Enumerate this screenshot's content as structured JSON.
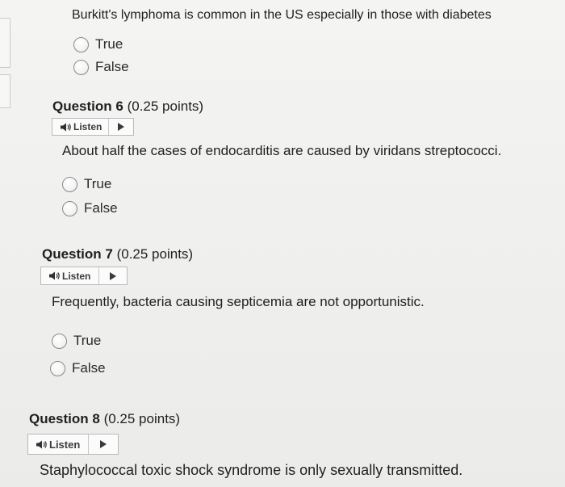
{
  "q5": {
    "text": "Burkitt's lymphoma is common in the US especially in those with diabetes",
    "options": [
      "True",
      "False"
    ]
  },
  "q6": {
    "heading": "Question 6",
    "points": " (0.25 points)",
    "listen_label": "Listen",
    "text": "About half the cases of endocarditis are caused by viridans streptococci.",
    "options": [
      "True",
      "False"
    ]
  },
  "q7": {
    "heading": "Question 7",
    "points": " (0.25 points)",
    "listen_label": "Listen",
    "text": "Frequently, bacteria causing septicemia are not opportunistic.",
    "options": [
      "True",
      "False"
    ]
  },
  "q8": {
    "heading": "Question 8",
    "points": " (0.25 points)",
    "listen_label": "Listen",
    "text": "Staphylococcal toxic shock syndrome is only sexually transmitted."
  },
  "icons": {
    "speaker": "speaker-icon",
    "play": "play-icon"
  },
  "colors": {
    "text": "#1f1f1f",
    "radio_border": "#8a8a8a",
    "button_border": "#b9b9b9"
  }
}
